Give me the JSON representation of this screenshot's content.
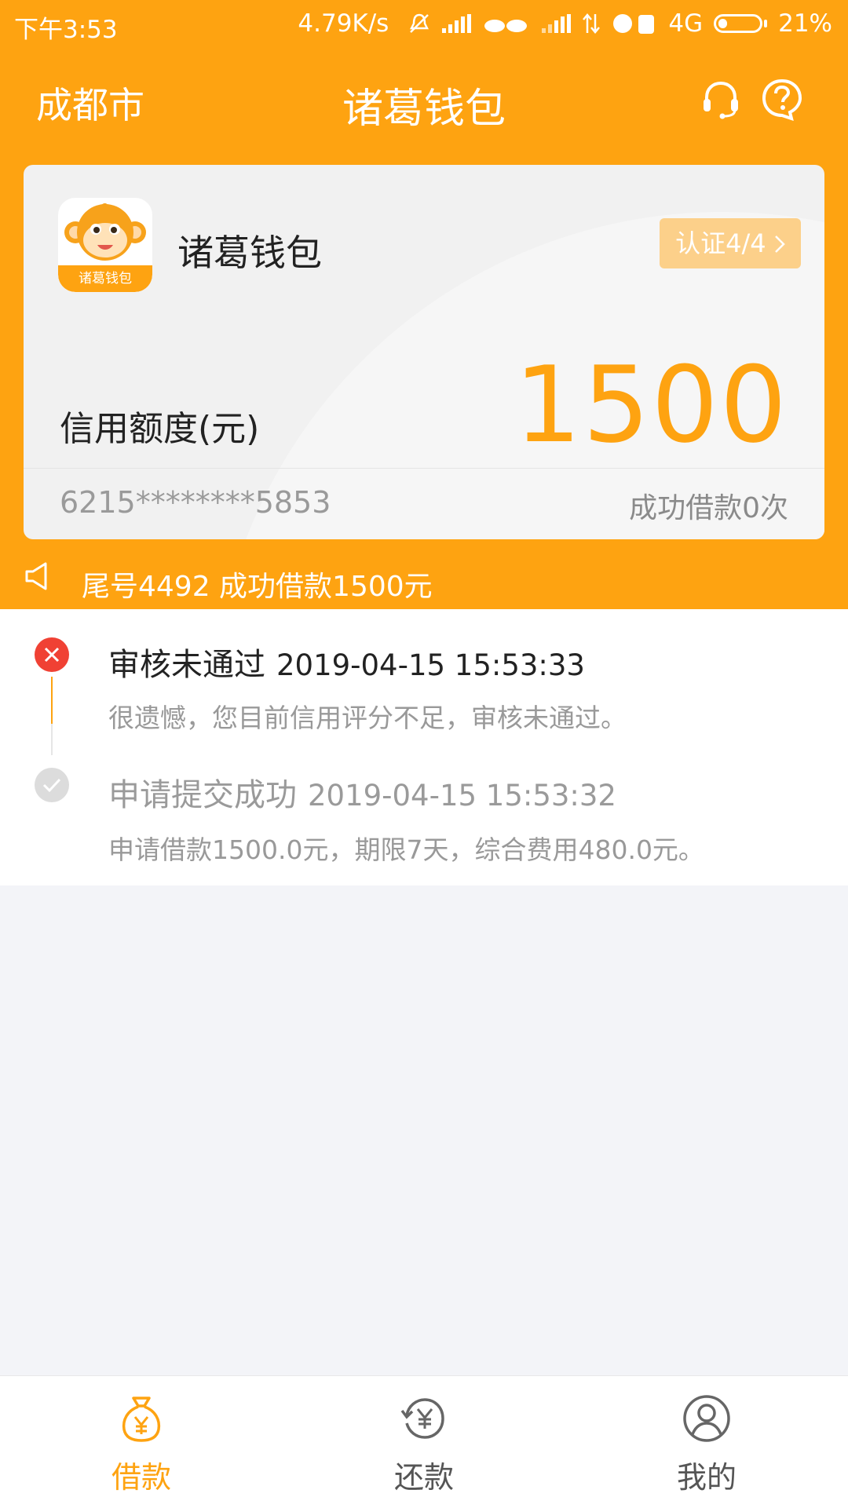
{
  "status_bar": {
    "time": "下午3:53",
    "net_speed": "4.79K/s",
    "network": "4G",
    "battery": "21%",
    "battery_level": 0.21
  },
  "header": {
    "city": "成都市",
    "title": "诸葛钱包",
    "icons": [
      "headset-icon",
      "help-icon"
    ]
  },
  "card": {
    "logo_text": "诸葛钱包",
    "name": "诸葛钱包",
    "cert_label": "认证4/4",
    "limit_label": "信用额度(元)",
    "amount": "1500",
    "card_number": "6215********5853",
    "success_count": "成功借款0次"
  },
  "notice": {
    "text": "尾号4492 成功借款1500元"
  },
  "timeline": [
    {
      "title": "审核未通过",
      "time": "2019-04-15 15:53:33",
      "desc": "很遗憾，您目前信用评分不足，审核未通过。",
      "status": "failed"
    },
    {
      "title": "申请提交成功",
      "time": "2019-04-15 15:53:32",
      "desc": "申请借款1500.0元，期限7天，综合费用480.0元。",
      "status": "done"
    }
  ],
  "bottom_nav": [
    {
      "label": "借款",
      "icon": "money-bag-icon",
      "active": true
    },
    {
      "label": "还款",
      "icon": "repay-icon",
      "active": false
    },
    {
      "label": "我的",
      "icon": "user-icon",
      "active": false
    }
  ],
  "colors": {
    "brand": "#fea311",
    "fail": "#f04134",
    "muted": "#999999"
  }
}
